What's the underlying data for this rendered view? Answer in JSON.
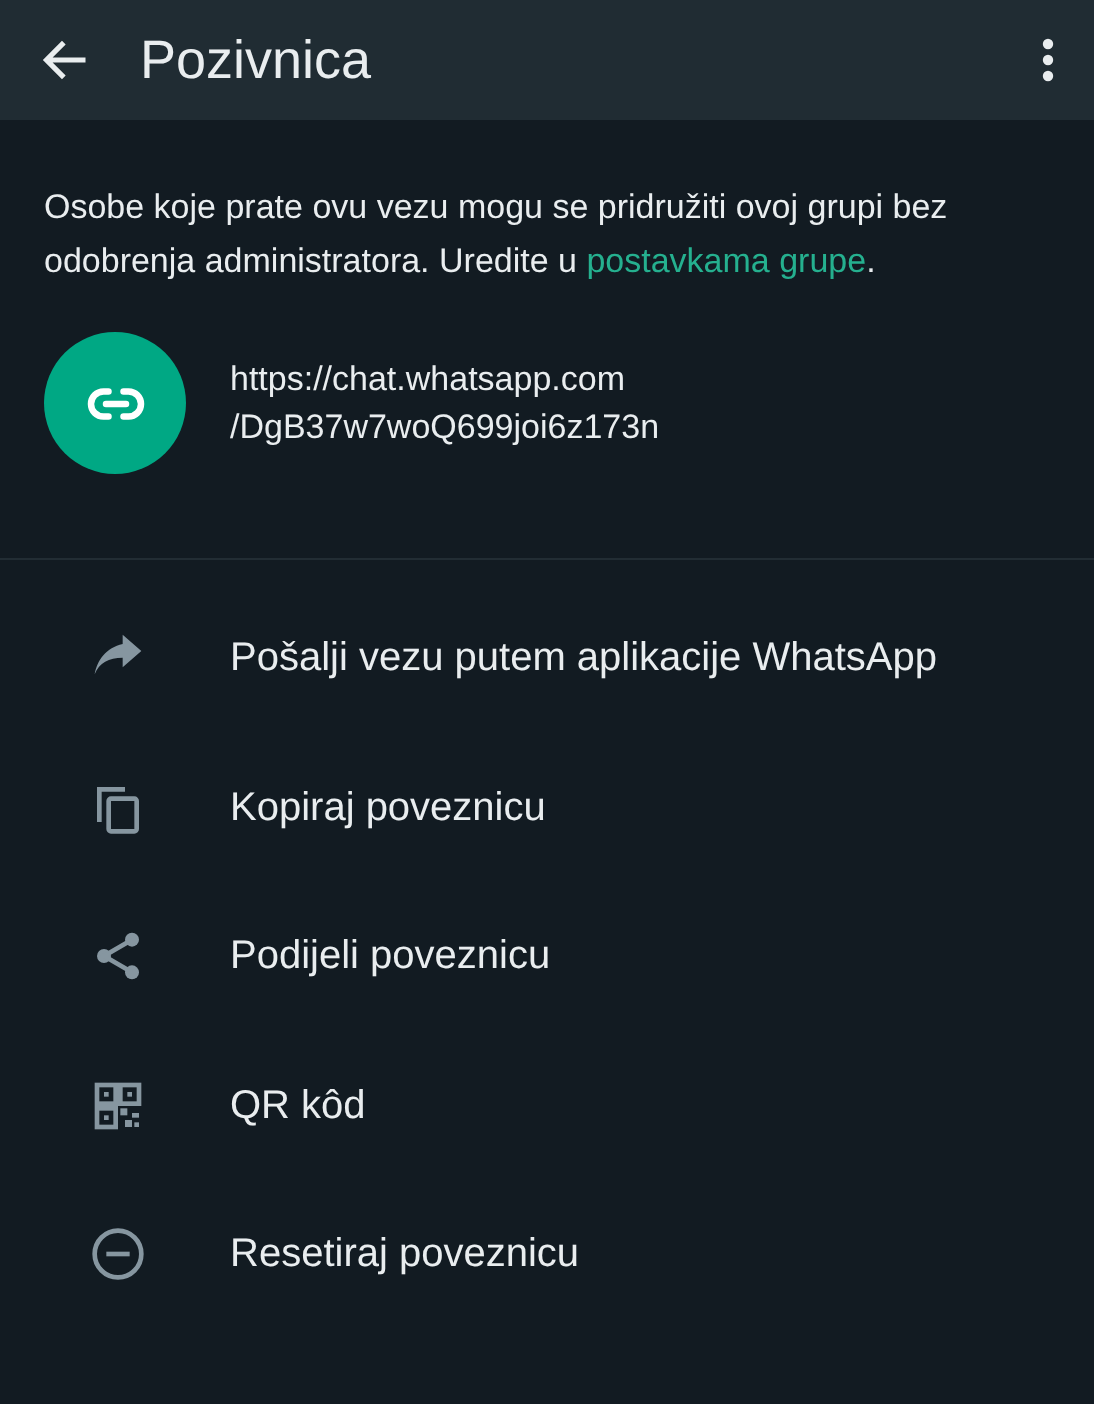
{
  "header": {
    "title": "Pozivnica"
  },
  "description": {
    "text": "Osobe koje prate ovu vezu mogu se pridružiti ovoj grupi bez odobrenja administratora. Uredite u",
    "link": "postavkama grupe",
    "suffix": "."
  },
  "invite_link": {
    "url_line_1": "https://chat.whatsapp.com",
    "url_line_2": "/DgB37w7woQ699joi6z173n"
  },
  "actions": [
    {
      "kind": "forward",
      "label": "Pošalji vezu putem aplikacije WhatsApp"
    },
    {
      "kind": "copy",
      "label": "Kopiraj poveznicu"
    },
    {
      "kind": "share",
      "label": "Podijeli poveznicu"
    },
    {
      "kind": "qr",
      "label": "QR kôd"
    },
    {
      "kind": "reset",
      "label": "Resetiraj poveznicu"
    }
  ]
}
